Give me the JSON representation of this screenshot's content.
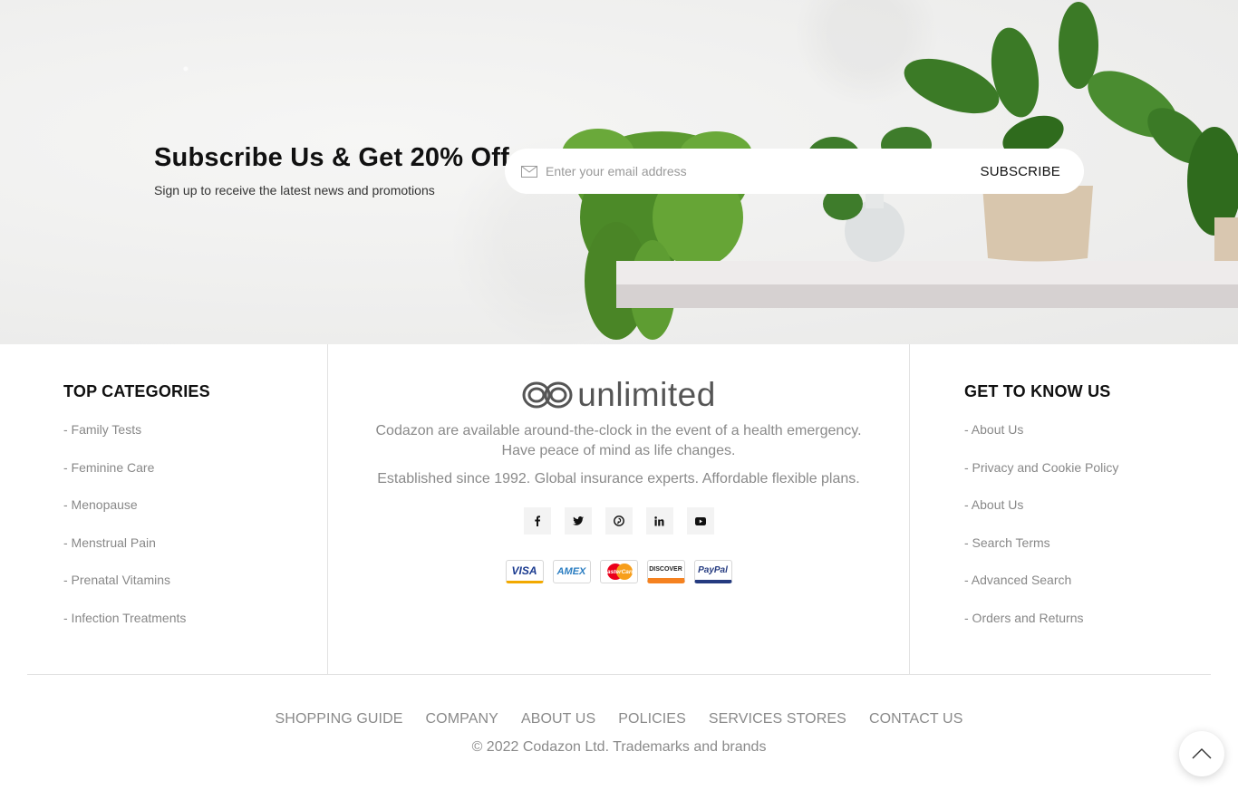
{
  "subscribe": {
    "title": "Subscribe Us & Get 20% Off",
    "description": "Sign up to receive the latest news and promotions",
    "placeholder": "Enter your email address",
    "button_label": "SUBSCRIBE"
  },
  "top_categories": {
    "heading": "TOP CATEGORIES",
    "items": [
      {
        "label": "- Family Tests"
      },
      {
        "label": "- Feminine Care"
      },
      {
        "label": "- Menopause"
      },
      {
        "label": "- Menstrual Pain"
      },
      {
        "label": "- Prenatal Vitamins"
      },
      {
        "label": "- Infection Treatments"
      }
    ]
  },
  "brand": {
    "logo_text": "unlimited",
    "about_line1": "Codazon are available around-the-clock in the event of a health emergency. Have peace of mind as life changes.",
    "about_line2": "Established since 1992. Global insurance experts. Affordable flexible plans.",
    "social": [
      {
        "icon": "facebook-icon",
        "glyph": "f"
      },
      {
        "icon": "twitter-icon",
        "glyph": "t"
      },
      {
        "icon": "pinterest-icon",
        "glyph": "p"
      },
      {
        "icon": "linkedin-icon",
        "glyph": "in"
      },
      {
        "icon": "youtube-icon",
        "glyph": "yt"
      }
    ],
    "payments": [
      {
        "name": "visa-icon",
        "label": "VISA",
        "color": "#1a3a8f"
      },
      {
        "name": "amex-icon",
        "label": "AMEX",
        "color": "#2a7dc1"
      },
      {
        "name": "mastercard-icon",
        "label": "MasterCard",
        "color": "#ffffff"
      },
      {
        "name": "discover-icon",
        "label": "DISCOVER",
        "color": "#222222"
      },
      {
        "name": "paypal-icon",
        "label": "PayPal",
        "color": "#253b80"
      }
    ]
  },
  "get_to_know": {
    "heading": "GET TO KNOW US",
    "items": [
      {
        "label": "- About Us"
      },
      {
        "label": "- Privacy and Cookie Policy"
      },
      {
        "label": "- About Us"
      },
      {
        "label": "- Search Terms"
      },
      {
        "label": "- Advanced Search"
      },
      {
        "label": "- Orders and Returns"
      }
    ]
  },
  "bottom_nav": [
    {
      "label": "SHOPPING GUIDE"
    },
    {
      "label": "COMPANY"
    },
    {
      "label": "ABOUT US"
    },
    {
      "label": "POLICIES"
    },
    {
      "label": "SERVICES STORES"
    },
    {
      "label": "CONTACT US"
    }
  ],
  "copyright": "© 2022 Codazon Ltd. Trademarks and brands",
  "colors": {
    "text_dark": "#111111",
    "text_muted": "#888888",
    "border": "#e2e2e2",
    "plant_green": "#3f7a2a"
  }
}
